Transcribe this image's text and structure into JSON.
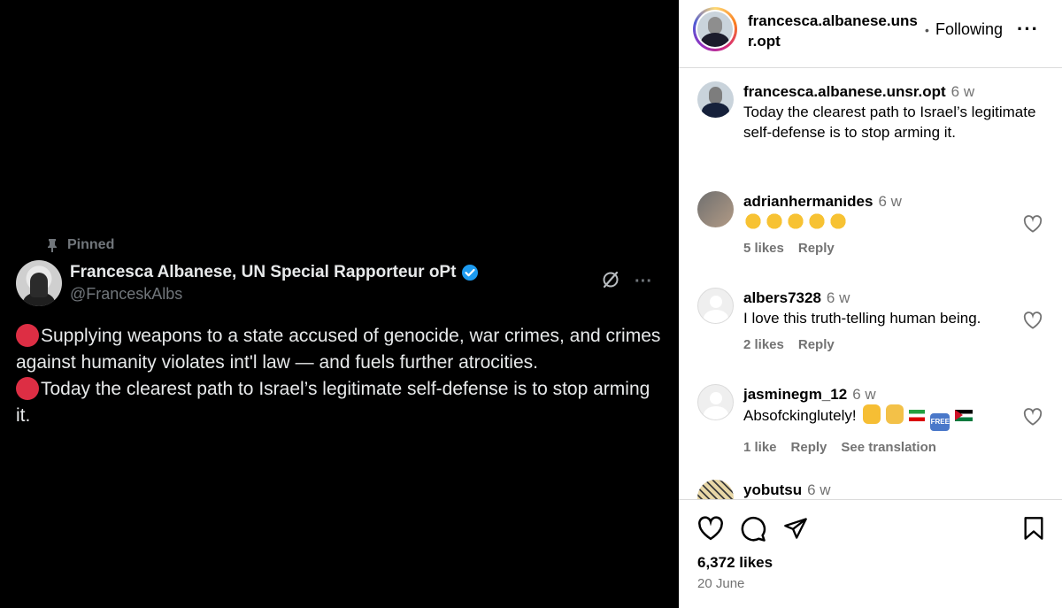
{
  "tweet": {
    "pinned_label": "Pinned",
    "display_name": "Francesca Albanese, UN Special Rapporteur oPt",
    "handle": "@FranceskAlbs",
    "line1": "Supplying weapons to a state accused of genocide, war crimes, and crimes against humanity violates int'l law — and fuels further atrocities.",
    "line2": "Today the clearest path to Israel’s legitimate self-defense is to stop arming it.",
    "more_glyph": "···"
  },
  "header": {
    "username": "francesca.albanese.unsr.opt",
    "separator": "•",
    "follow_label": "Following",
    "more_glyph": "···"
  },
  "caption": {
    "username": "francesca.albanese.unsr.opt",
    "time": "6 w",
    "text": "Today the clearest path to Israel’s legitimate self-defense is to stop arming it."
  },
  "comments": [
    {
      "username": "adrianhermanides",
      "time": "6 w",
      "text": "",
      "emoji": "clapping-hands x5",
      "likes": "5 likes",
      "reply": "Reply",
      "translate": ""
    },
    {
      "username": "albers7328",
      "time": "6 w",
      "text": "I love this truth-telling human being.",
      "likes": "2 likes",
      "reply": "Reply",
      "translate": ""
    },
    {
      "username": "jasminegm_12",
      "time": "6 w",
      "text": "Absofckinglutely!",
      "emoji": "fist open-hands iran-flag free-button palestine-flag",
      "likes": "1 like",
      "reply": "Reply",
      "translate": "See translation"
    },
    {
      "username": "yobutsu",
      "time": "6 w"
    }
  ],
  "footer": {
    "likes": "6,372 likes",
    "date": "20 June"
  },
  "colors": {
    "verified": "#1d9bf0",
    "red_circle": "#dd2e44",
    "secondary_text": "#737373"
  }
}
